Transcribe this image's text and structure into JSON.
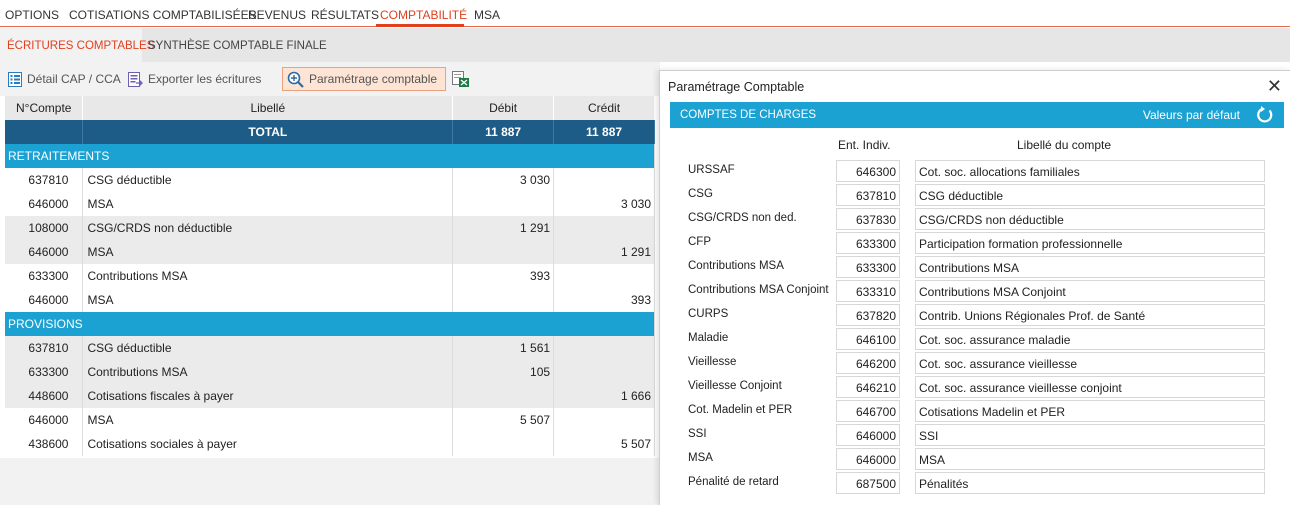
{
  "topnav": {
    "items": [
      {
        "label": "OPTIONS"
      },
      {
        "label": "COTISATIONS COMPTABILISÉES"
      },
      {
        "label": "REVENUS"
      },
      {
        "label": "RÉSULTATS"
      },
      {
        "label": "COMPTABILITÉ"
      },
      {
        "label": "MSA"
      }
    ],
    "active": "COMPTABILITÉ"
  },
  "subtabs": {
    "items": [
      {
        "label": "ÉCRITURES COMPTABLES"
      },
      {
        "label": "SYNTHÈSE COMPTABLE FINALE"
      }
    ],
    "active": "ÉCRITURES COMPTABLES"
  },
  "toolbar": {
    "detail_label": "Détail CAP / CCA",
    "export_label": "Exporter les écritures",
    "param_label": "Paramétrage comptable",
    "excel_icon": "excel-export-icon"
  },
  "table": {
    "headers": [
      "N°Compte",
      "Libellé",
      "Débit",
      "Crédit"
    ],
    "total": {
      "label": "TOTAL",
      "debit": "11 887",
      "credit": "11 887"
    },
    "sections": [
      {
        "title": "RETRAITEMENTS",
        "rows": [
          {
            "code": "637810",
            "label": "CSG déductible",
            "debit": "3 030",
            "credit": ""
          },
          {
            "code": "646000",
            "label": "MSA",
            "debit": "",
            "credit": "3 030"
          },
          {
            "code": "108000",
            "label": "CSG/CRDS non déductible",
            "debit": "1 291",
            "credit": ""
          },
          {
            "code": "646000",
            "label": "MSA",
            "debit": "",
            "credit": "1 291"
          },
          {
            "code": "633300",
            "label": "Contributions MSA",
            "debit": "393",
            "credit": ""
          },
          {
            "code": "646000",
            "label": "MSA",
            "debit": "",
            "credit": "393"
          }
        ]
      },
      {
        "title": "PROVISIONS",
        "rows": [
          {
            "code": "637810",
            "label": "CSG déductible",
            "debit": "1 561",
            "credit": ""
          },
          {
            "code": "633300",
            "label": "Contributions MSA",
            "debit": "105",
            "credit": ""
          },
          {
            "code": "448600",
            "label": "Cotisations fiscales à payer",
            "debit": "",
            "credit": "1 666"
          },
          {
            "code": "646000",
            "label": "MSA",
            "debit": "5 507",
            "credit": ""
          },
          {
            "code": "438600",
            "label": "Cotisations sociales à payer",
            "debit": "",
            "credit": "5 507"
          }
        ]
      }
    ]
  },
  "modal": {
    "title": "Paramétrage Comptable",
    "section_label": "COMPTES DE CHARGES",
    "reset_label": "Valeurs par défaut",
    "col_code": "Ent. Indiv.",
    "col_label": "Libellé du compte",
    "rows": [
      {
        "name": "URSSAF",
        "code": "646300",
        "label": "Cot. soc. allocations familiales"
      },
      {
        "name": "CSG",
        "code": "637810",
        "label": "CSG déductible"
      },
      {
        "name": "CSG/CRDS non ded.",
        "code": "637830",
        "label": "CSG/CRDS non déductible"
      },
      {
        "name": "CFP",
        "code": "633300",
        "label": "Participation formation professionnelle"
      },
      {
        "name": "Contributions MSA",
        "code": "633300",
        "label": "Contributions MSA"
      },
      {
        "name": "Contributions MSA Conjoint",
        "code": "633310",
        "label": "Contributions MSA Conjoint"
      },
      {
        "name": "CURPS",
        "code": "637820",
        "label": "Contrib. Unions Régionales Prof. de Santé"
      },
      {
        "name": "Maladie",
        "code": "646100",
        "label": "Cot. soc. assurance maladie"
      },
      {
        "name": "Vieillesse",
        "code": "646200",
        "label": "Cot. soc. assurance vieillesse"
      },
      {
        "name": "Vieillesse Conjoint",
        "code": "646210",
        "label": "Cot. soc. assurance vieillesse conjoint"
      },
      {
        "name": "Cot. Madelin et PER",
        "code": "646700",
        "label": "Cotisations Madelin et PER"
      },
      {
        "name": "SSI",
        "code": "646000",
        "label": "SSI"
      },
      {
        "name": "MSA",
        "code": "646000",
        "label": "MSA"
      },
      {
        "name": "Pénalité de retard",
        "code": "687500",
        "label": "Pénalités"
      }
    ]
  },
  "colors": {
    "accent": "#e0401e",
    "section_blue": "#1ba2d3",
    "total_navy": "#1d5c86"
  }
}
